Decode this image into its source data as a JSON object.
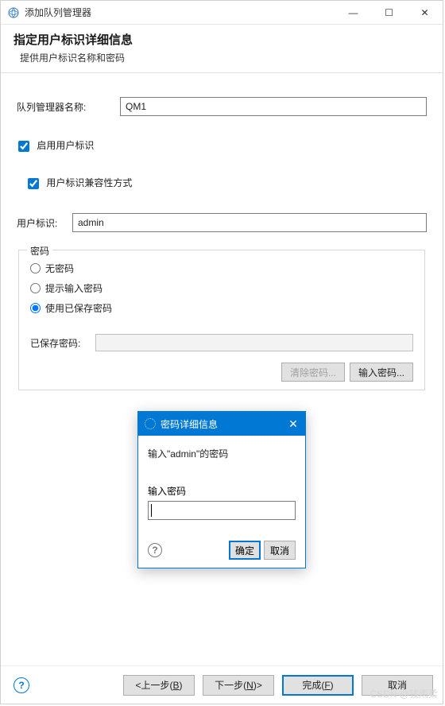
{
  "window": {
    "title": "添加队列管理器",
    "minimize": "—",
    "maximize": "☐",
    "close": "✕"
  },
  "header": {
    "title": "指定用户标识详细信息",
    "subtitle": "提供用户标识名称和密码"
  },
  "form": {
    "qm_name_label": "队列管理器名称:",
    "qm_name_value": "QM1",
    "enable_userid_label": "启用用户标识",
    "userid_compat_label": "用户标识兼容性方式",
    "userid_label": "用户标识:",
    "userid_value": "admin"
  },
  "password_group": {
    "title": "密码",
    "radio_none": "无密码",
    "radio_prompt": "提示输入密码",
    "radio_saved": "使用已保存密码",
    "saved_pw_label": "已保存密码:",
    "saved_pw_value": "",
    "clear_btn": "清除密码...",
    "input_btn": "输入密码..."
  },
  "dialog": {
    "title": "密码详细信息",
    "message": "输入\"admin\"的密码",
    "input_label": "输入密码",
    "input_value": "",
    "ok": "确定",
    "cancel": "取消",
    "close": "✕",
    "help": "?"
  },
  "bottom": {
    "help": "?",
    "back": "<上一步(",
    "back_u": "B",
    "back_end": ")",
    "next": "下一步(",
    "next_u": "N",
    "next_end": ")>",
    "finish": "完成(",
    "finish_u": "F",
    "finish_end": ")",
    "cancel": "取消"
  },
  "watermark": "CSDN @钱雨柔"
}
